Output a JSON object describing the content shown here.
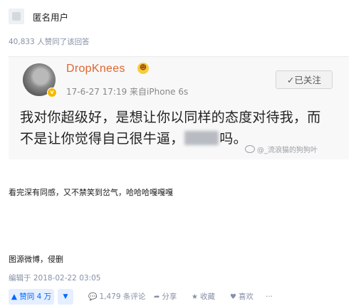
{
  "header": {
    "username": "匿名用户",
    "upvote_info": "40,833 人赞同了该回答"
  },
  "weibo_card": {
    "author": "DropKnees",
    "time_source": "17-6-27 17:19  来自iPhone 6s",
    "follow_label": "✓已关注",
    "post_line1": "我对你超级好，是想让你以同样的态度对待我，而",
    "post_line2_start": "不是让你觉得自己很牛逼，",
    "post_line2_end": "吗。",
    "watermark": "@_流浪猫的狗狗叶"
  },
  "answer": {
    "paragraph1": "看完深有同感，又不禁笑到岔气，哈哈哈嘎嘎嘎",
    "paragraph2": "图源微博，侵删",
    "edited": "编辑于 2018-02-22 03:05"
  },
  "actions": {
    "vote_label": "▲ 赞同 4 万",
    "down_label": "▼",
    "comments": "1,479 条评论",
    "share": "分享",
    "collect": "收藏",
    "like": "喜欢",
    "more": "···"
  },
  "colors": {
    "accent": "#0066ff",
    "meta": "#8590a6",
    "weibo_name": "#e1662e"
  }
}
